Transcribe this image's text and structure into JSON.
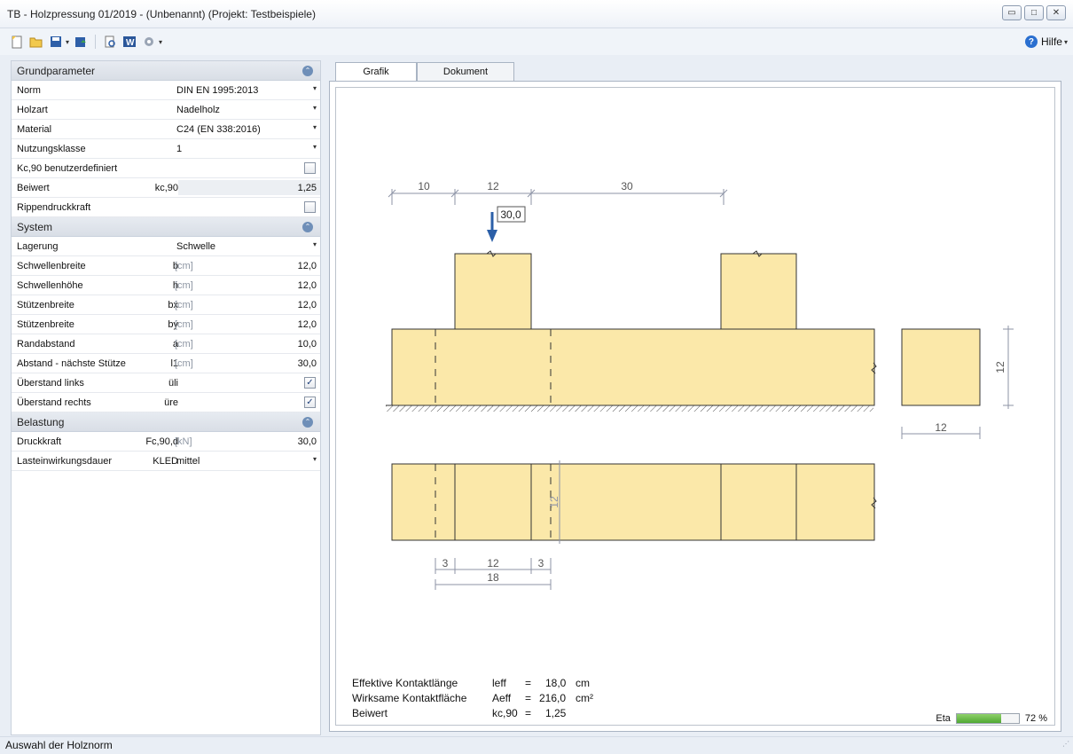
{
  "window": {
    "title": "TB - Holzpressung 01/2019 - (Unbenannt) (Projekt: Testbeispiele)",
    "min_glyph": "▭",
    "max_glyph": "□",
    "close_glyph": "✕"
  },
  "toolbar": {
    "icons": [
      "new-icon",
      "open-icon",
      "save-icon",
      "export-icon",
      "print-preview-icon",
      "word-icon",
      "settings-icon"
    ],
    "help_label": "Hilfe"
  },
  "sections": {
    "grundparameter": {
      "title": "Grundparameter",
      "rows": {
        "norm": {
          "label": "Norm",
          "value": "DIN EN 1995:2013"
        },
        "holzart": {
          "label": "Holzart",
          "value": "Nadelholz"
        },
        "material": {
          "label": "Material",
          "value": "C24 (EN 338:2016)"
        },
        "nutzungsklasse": {
          "label": "Nutzungsklasse",
          "value": "1"
        },
        "kc90_user": {
          "label": "Kc,90 benutzerdefiniert",
          "checked": false
        },
        "beiwert": {
          "label": "Beiwert",
          "symbol": "kc,90",
          "value": "1,25"
        },
        "rippendruckkraft": {
          "label": "Rippendruckkraft",
          "checked": false
        }
      }
    },
    "system": {
      "title": "System",
      "rows": {
        "lagerung": {
          "label": "Lagerung",
          "value": "Schwelle"
        },
        "schwellenbreite": {
          "label": "Schwellenbreite",
          "symbol": "b",
          "unit": "[cm]",
          "value": "12,0"
        },
        "schwellenhoehe": {
          "label": "Schwellenhöhe",
          "symbol": "h",
          "unit": "[cm]",
          "value": "12,0"
        },
        "stuetzenbreite_x": {
          "label": "Stützenbreite",
          "symbol": "bx",
          "unit": "[cm]",
          "value": "12,0"
        },
        "stuetzenbreite_y": {
          "label": "Stützenbreite",
          "symbol": "by",
          "unit": "[cm]",
          "value": "12,0"
        },
        "randabstand": {
          "label": "Randabstand",
          "symbol": "a",
          "unit": "[cm]",
          "value": "10,0"
        },
        "abstand": {
          "label": "Abstand - nächste Stütze",
          "symbol": "l1",
          "unit": "[cm]",
          "value": "30,0"
        },
        "ueberstand_links": {
          "label": "Überstand links",
          "symbol": "üli",
          "checked": true
        },
        "ueberstand_rechts": {
          "label": "Überstand rechts",
          "symbol": "üre",
          "checked": true
        }
      }
    },
    "belastung": {
      "title": "Belastung",
      "rows": {
        "druckkraft": {
          "label": "Druckkraft",
          "symbol": "Fc,90,d",
          "unit": "[kN]",
          "value": "30,0"
        },
        "lasteinwirkung": {
          "label": "Lasteinwirkungsdauer",
          "symbol": "KLED",
          "value": "mittel"
        }
      }
    }
  },
  "tabs": {
    "grafik": "Grafik",
    "dokument": "Dokument"
  },
  "drawing": {
    "dim_top": [
      "10",
      "12",
      "30"
    ],
    "load_label": "30,0",
    "dim_side_height": "12",
    "dim_side_width": "12",
    "dim_plan_height": "12",
    "dim_bottom_parts": [
      "3",
      "12",
      "3"
    ],
    "dim_bottom_total": "18",
    "colors": {
      "wood": "#fbe8a9",
      "dim": "#8d93a6",
      "load": "#2b5fa8"
    }
  },
  "results": {
    "leff": {
      "label": "Effektive Kontaktlänge",
      "symbol": "leff",
      "eq": "=",
      "value": "18,0",
      "unit": "cm"
    },
    "aeff": {
      "label": "Wirksame Kontaktfläche",
      "symbol": "Aeff",
      "eq": "=",
      "value": "216,0",
      "unit": "cm²"
    },
    "kc90": {
      "label": "Beiwert",
      "symbol": "kc,90",
      "eq": "=",
      "value": "1,25",
      "unit": ""
    }
  },
  "eta": {
    "label": "Eta",
    "value_text": "72 %",
    "fraction": 0.72
  },
  "status": {
    "text": "Auswahl der Holznorm"
  }
}
